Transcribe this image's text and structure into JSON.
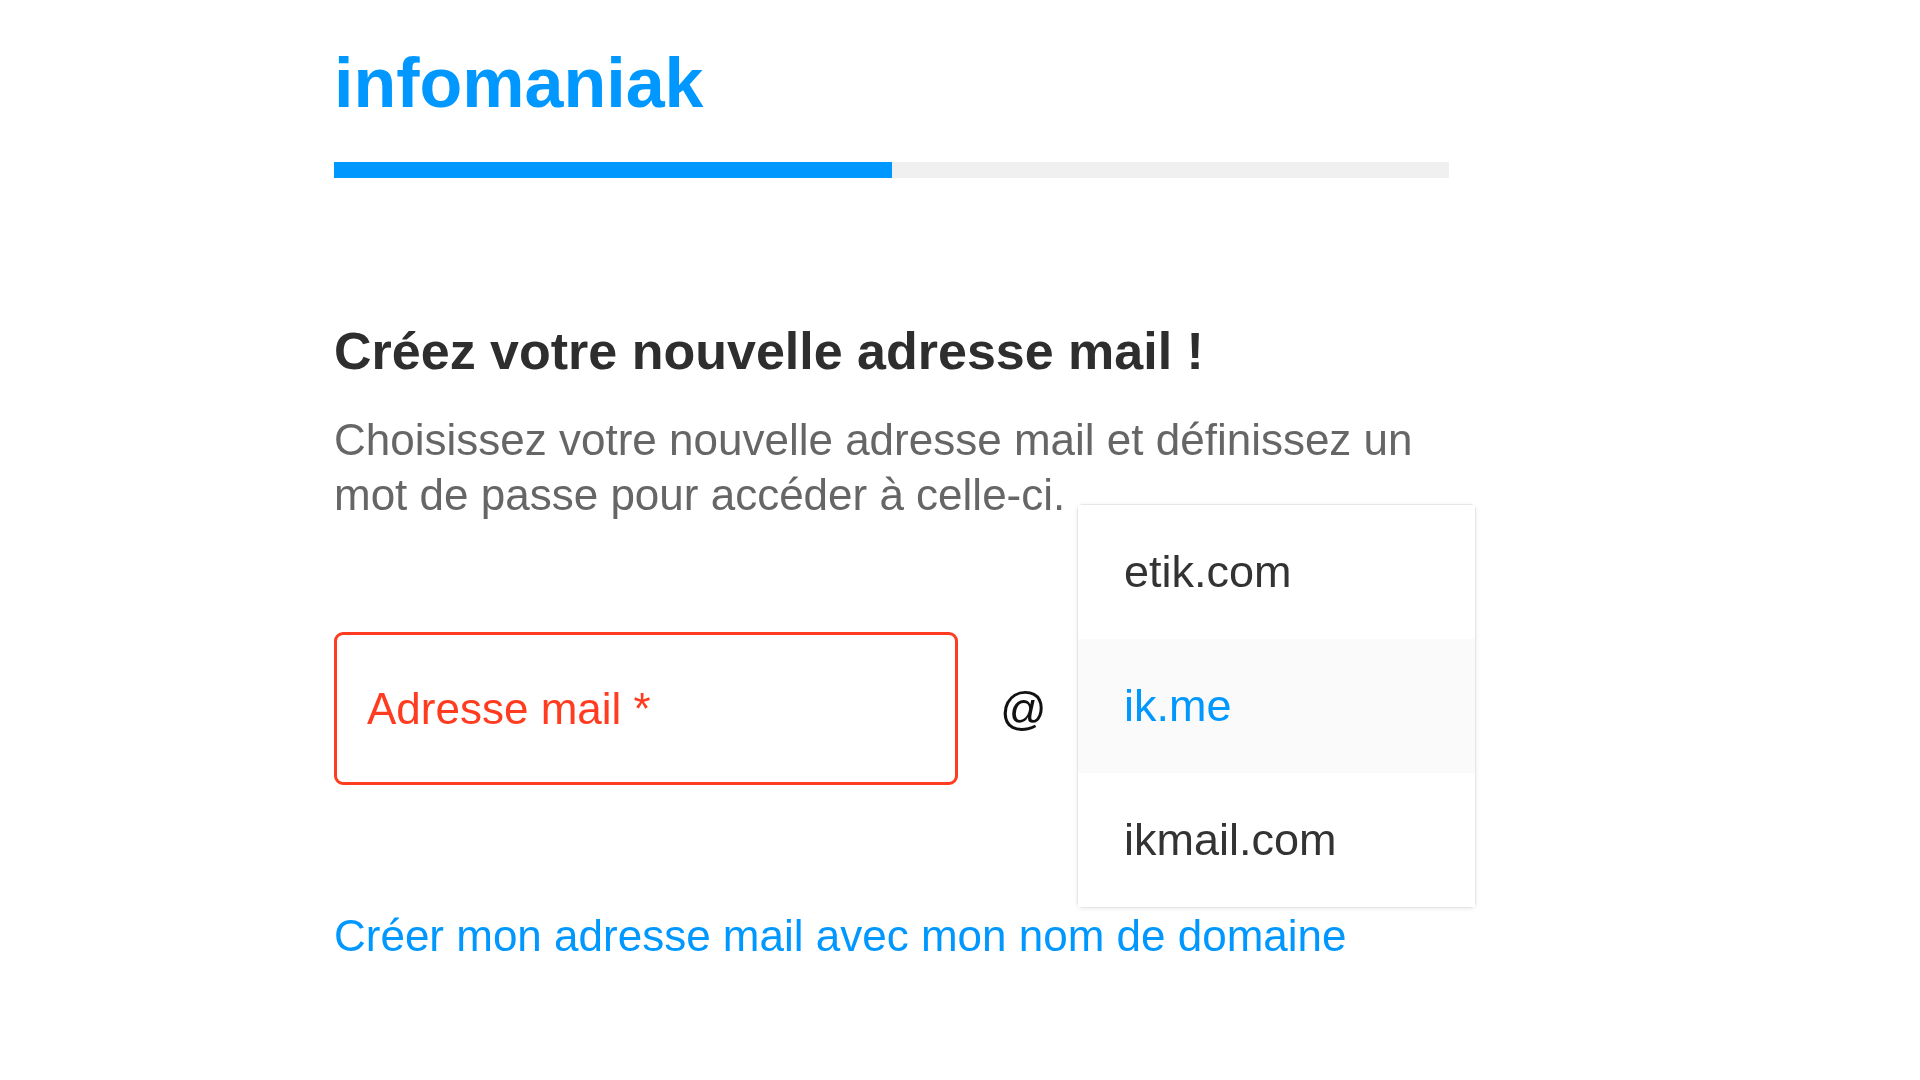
{
  "logo": {
    "text": "infomaniak"
  },
  "progress": {
    "level": 0.5
  },
  "heading": "Créez votre nouvelle adresse mail !",
  "description": "Choisissez votre nouvelle adresse mail et définissez un mot de passe pour accéder à celle-ci.",
  "email_field": {
    "placeholder": "Adresse mail *",
    "error": true
  },
  "at_sign": "@",
  "domain_options": [
    {
      "label": "etik.com",
      "selected": false
    },
    {
      "label": "ik.me",
      "selected": true
    },
    {
      "label": "ikmail.com",
      "selected": false
    }
  ],
  "domain_link": "Créer mon adresse mail avec mon nom de domaine"
}
